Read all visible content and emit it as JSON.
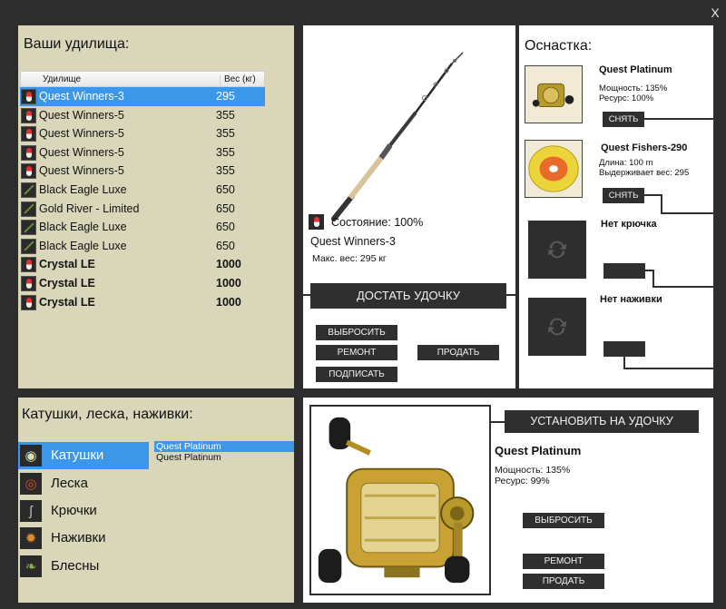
{
  "window": {
    "close_label": "X"
  },
  "rods_panel": {
    "title": "Ваши удилища:",
    "col_name": "Удилище",
    "col_weight": "Вес (кг)",
    "rows": [
      {
        "name": "Quest Winners-3",
        "weight": "295",
        "icon": "float-icon"
      },
      {
        "name": "Quest Winners-5",
        "weight": "355",
        "icon": "float-icon"
      },
      {
        "name": "Quest Winners-5",
        "weight": "355",
        "icon": "float-icon"
      },
      {
        "name": "Quest Winners-5",
        "weight": "355",
        "icon": "float-icon"
      },
      {
        "name": "Quest Winners-5",
        "weight": "355",
        "icon": "float-icon"
      },
      {
        "name": "Black Eagle Luxe",
        "weight": "650",
        "icon": "rod-icon"
      },
      {
        "name": "Gold River - Limited",
        "weight": "650",
        "icon": "rod-icon"
      },
      {
        "name": "Black Eagle Luxe",
        "weight": "650",
        "icon": "rod-icon"
      },
      {
        "name": "Black Eagle Luxe",
        "weight": "650",
        "icon": "rod-icon"
      },
      {
        "name": "Crystal LE",
        "weight": "1000",
        "icon": "float-icon"
      },
      {
        "name": "Crystal LE",
        "weight": "1000",
        "icon": "float-icon"
      },
      {
        "name": "Crystal LE",
        "weight": "1000",
        "icon": "float-icon"
      }
    ]
  },
  "rod_detail": {
    "state": "Состояние: 100%",
    "name": "Quest Winners-3",
    "max_weight": "Макс. вес: 295 кг",
    "get_rod": "ДОСТАТЬ УДОЧКУ",
    "throw_away": "ВЫБРОСИТЬ",
    "repair": "РЕМОНТ",
    "sell": "ПРОДАТЬ",
    "sign": "ПОДПИСАТЬ"
  },
  "equipment": {
    "title": "Оснастка:",
    "reel": {
      "name": "Quest Platinum",
      "power": "Мощность: 135%",
      "resource": "Ресурс: 100%",
      "remove": "СНЯТЬ"
    },
    "line": {
      "name": "Quest Fishers-290",
      "length": "Длина: 100 m",
      "holds": "Выдерживает вес: 295",
      "remove": "СНЯТЬ"
    },
    "hook_empty": "Нет крючка",
    "bait_empty": "Нет наживки"
  },
  "categories_panel": {
    "title": "Катушки, леска, наживки:",
    "items": [
      {
        "label": "Катушки",
        "icon": "reel-icon"
      },
      {
        "label": "Леска",
        "icon": "line-icon"
      },
      {
        "label": "Крючки",
        "icon": "hook-icon"
      },
      {
        "label": "Наживки",
        "icon": "bait-icon"
      },
      {
        "label": "Блесны",
        "icon": "lure-icon"
      }
    ],
    "sub_items": [
      "Quest Platinum",
      "Quest Platinum"
    ]
  },
  "reel_detail": {
    "install": "УСТАНОВИТЬ НА УДОЧКУ",
    "name": "Quest Platinum",
    "power": "Мощность: 135%",
    "resource": "Ресурс: 99%",
    "throw_away": "ВЫБРОСИТЬ",
    "repair": "РЕМОНТ",
    "sell": "ПРОДАТЬ"
  }
}
